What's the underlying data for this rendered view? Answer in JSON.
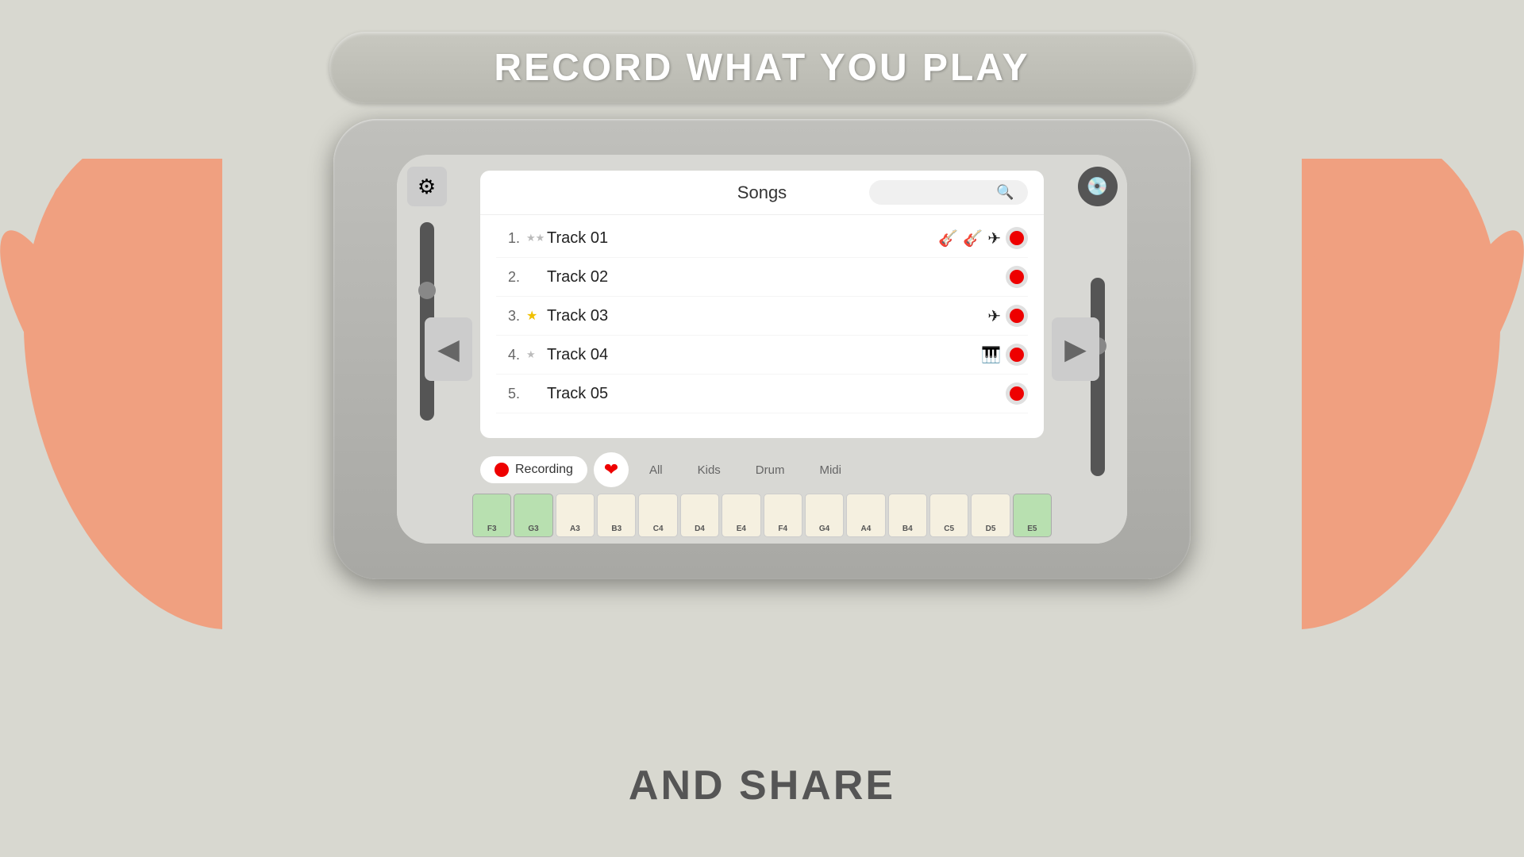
{
  "banner": {
    "top_text": "RECORD WHAT YOU PLAY",
    "bottom_text": "AND SHARE"
  },
  "songs_panel": {
    "title": "Songs",
    "search_placeholder": ""
  },
  "tracks": [
    {
      "number": "1.",
      "name": "Track 01",
      "star": "☆☆",
      "star_type": "empty_double",
      "icons": [
        "guitar",
        "guitar-cross",
        "satellite"
      ],
      "has_record": true
    },
    {
      "number": "2.",
      "name": "Track 02",
      "star": "",
      "star_type": "none",
      "icons": [],
      "has_record": true
    },
    {
      "number": "3.",
      "name": "Track 03",
      "star": "★",
      "star_type": "gold",
      "icons": [
        "satellite"
      ],
      "has_record": true
    },
    {
      "number": "4.",
      "name": "Track 04",
      "star": "☆",
      "star_type": "empty",
      "icons": [
        "piano"
      ],
      "has_record": true
    },
    {
      "number": "5.",
      "name": "Track 05",
      "star": "",
      "star_type": "none",
      "icons": [],
      "has_record": true
    }
  ],
  "tabs": {
    "recording_label": "Recording",
    "items": [
      "All",
      "Kids",
      "Drum",
      "Midi"
    ]
  },
  "piano_keys": [
    {
      "label": "F3",
      "type": "green"
    },
    {
      "label": "G3",
      "type": "green"
    },
    {
      "label": "A3",
      "type": "white"
    },
    {
      "label": "B3",
      "type": "white"
    },
    {
      "label": "C4",
      "type": "white"
    },
    {
      "label": "D4",
      "type": "white"
    },
    {
      "label": "E4",
      "type": "white"
    },
    {
      "label": "F4",
      "type": "white"
    },
    {
      "label": "G4",
      "type": "white"
    },
    {
      "label": "A4",
      "type": "white"
    },
    {
      "label": "B4",
      "type": "white"
    },
    {
      "label": "C5",
      "type": "white"
    },
    {
      "label": "D5",
      "type": "white"
    },
    {
      "label": "E5",
      "type": "green"
    }
  ]
}
